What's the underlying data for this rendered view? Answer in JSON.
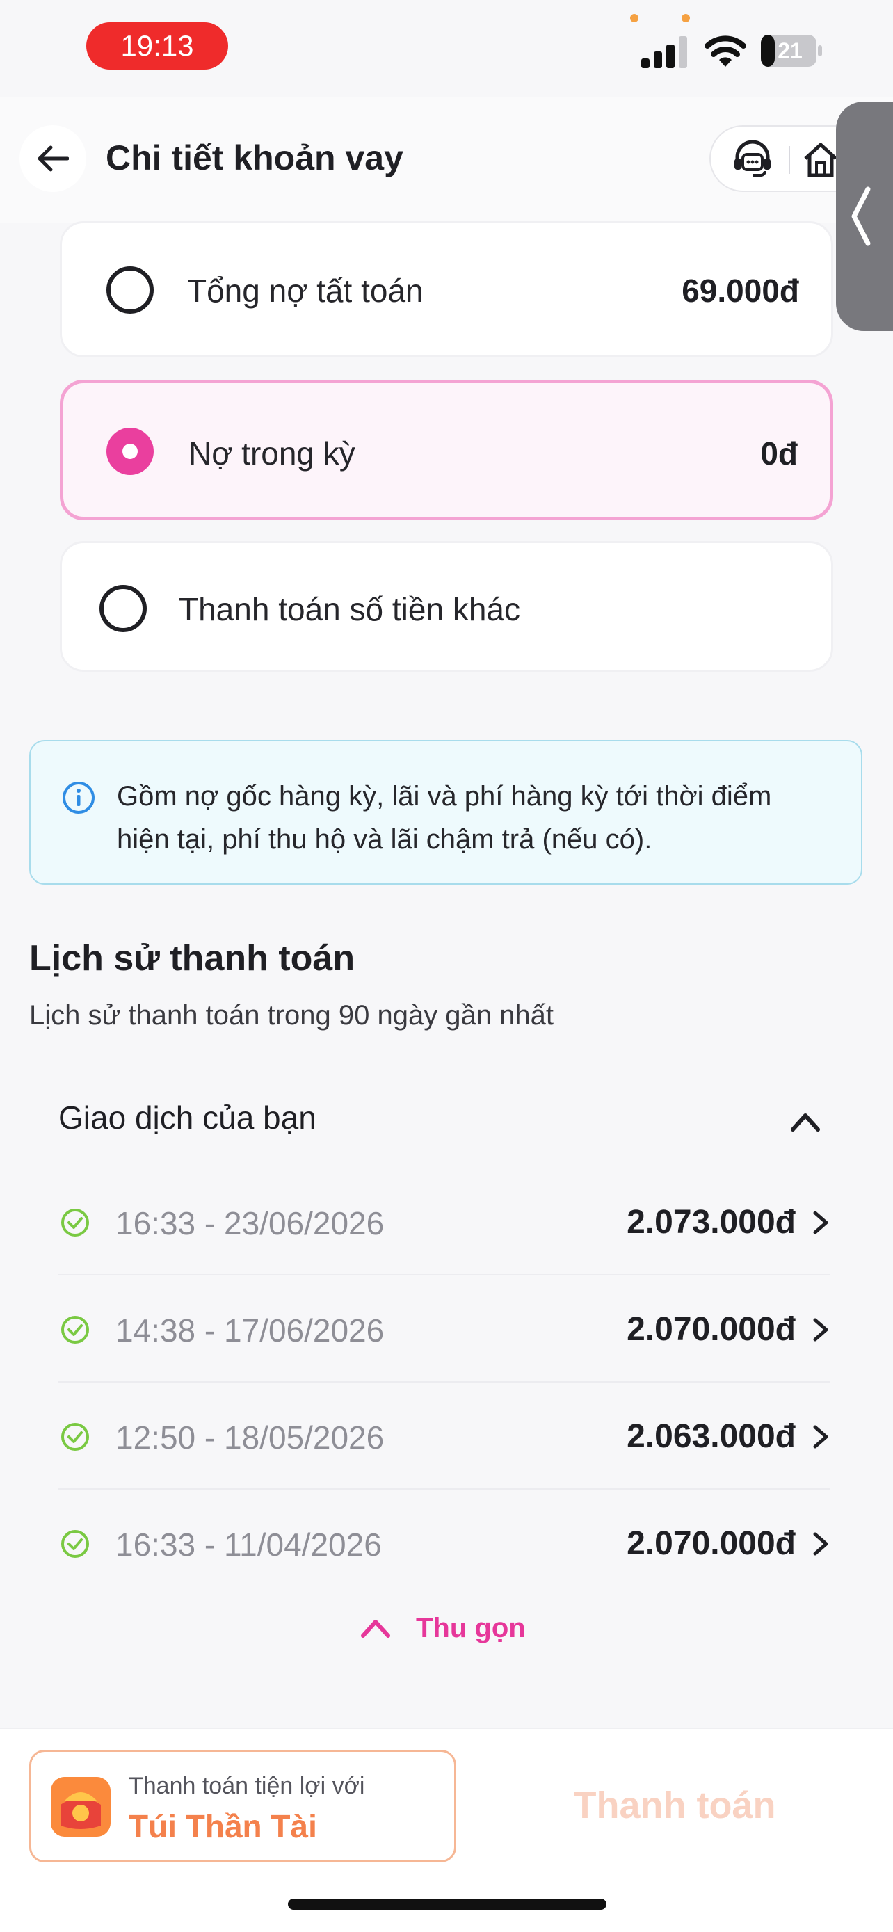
{
  "status_bar": {
    "time": "19:13",
    "battery": "21"
  },
  "header": {
    "title": "Chi tiết khoản vay"
  },
  "payment_options": [
    {
      "label": "Tổng nợ tất toán",
      "amount": "69.000đ",
      "selected": false
    },
    {
      "label": "Nợ trong kỳ",
      "amount": "0đ",
      "selected": true
    },
    {
      "label": "Thanh toán số tiền khác",
      "amount": "",
      "selected": false
    }
  ],
  "info": {
    "line1": "Gồm nợ gốc hàng kỳ, lãi và phí hàng kỳ tới thời điểm",
    "line2": "hiện tại, phí thu hộ và lãi chậm trả (nếu có)."
  },
  "history": {
    "title": "Lịch sử thanh toán",
    "subtitle": "Lịch sử thanh toán trong 90 ngày gần nhất",
    "section_label": "Giao dịch của bạn",
    "transactions": [
      {
        "time": "16:33 - 23/06/2026",
        "amount": "2.073.000đ",
        "status": "success"
      },
      {
        "time": "14:38 - 17/06/2026",
        "amount": "2.070.000đ",
        "status": "success"
      },
      {
        "time": "12:50 - 18/05/2026",
        "amount": "2.063.000đ",
        "status": "success"
      },
      {
        "time": "16:33 - 11/04/2026",
        "amount": "2.070.000đ",
        "status": "success"
      }
    ],
    "collapse_label": "Thu gọn"
  },
  "bottom": {
    "wallet_subtitle": "Thanh toán tiện lợi với",
    "wallet_name": "Túi Thần Tài",
    "pay_label": "Thanh toán"
  },
  "colors": {
    "accent_pink": "#ea3f9e",
    "success_green": "#7ac943",
    "wallet_orange": "#f4814c",
    "status_time_red": "#ef2b2b"
  },
  "icons": [
    "back-arrow-icon",
    "customer-support-icon",
    "home-icon",
    "chevron-left-icon",
    "info-icon",
    "check-circle-icon",
    "chevron-right-icon",
    "chevron-up-icon",
    "wallet-icon"
  ]
}
